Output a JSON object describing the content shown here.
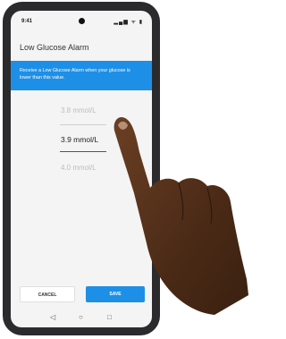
{
  "status": {
    "time": "9:41",
    "icons": "▂▄▆ ᯤ ▮"
  },
  "header": {
    "title": "Low Glucose Alarm"
  },
  "banner": {
    "text": "Receive a Low Glucose Alarm when your glucose is lower than this value."
  },
  "picker": {
    "options": [
      "3.8 mmol/L",
      "3.9 mmol/L",
      "4.0 mmol/L"
    ],
    "selected_index": 1
  },
  "actions": {
    "cancel_label": "CANCEL",
    "save_label": "SAVE"
  },
  "nav": {
    "back": "◁",
    "home": "○",
    "recents": "□"
  },
  "colors": {
    "accent": "#1e8fe6"
  }
}
